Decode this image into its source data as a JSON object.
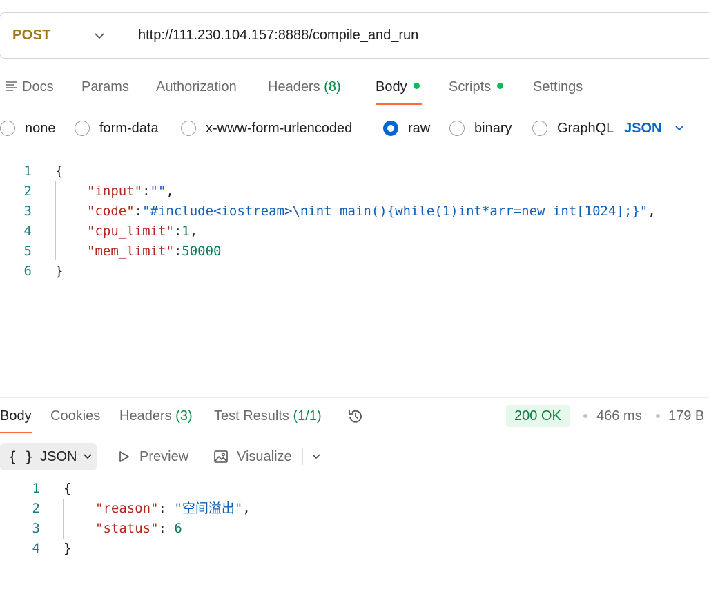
{
  "request": {
    "method": "POST",
    "url": "http://111.230.104.157:8888/compile_and_run"
  },
  "request_tabs": {
    "docs": "Docs",
    "params": "Params",
    "authorization": "Authorization",
    "headers": "Headers",
    "headers_count": "(8)",
    "body": "Body",
    "scripts": "Scripts",
    "settings": "Settings",
    "active": "Body"
  },
  "body_types": {
    "none": "none",
    "form_data": "form-data",
    "urlencoded": "x-www-form-urlencoded",
    "raw": "raw",
    "binary": "binary",
    "graphql": "GraphQL",
    "selected": "raw",
    "format": "JSON"
  },
  "request_body": {
    "line_numbers": [
      "1",
      "2",
      "3",
      "4",
      "5",
      "6"
    ],
    "open_brace": "{",
    "close_brace": "}",
    "input_key": "\"input\"",
    "input_value": "\"\"",
    "code_key": "\"code\"",
    "code_value": "\"#include<iostream>\\nint main(){while(1)int*arr=new int[1024];}\"",
    "cpu_limit_key": "\"cpu_limit\"",
    "cpu_limit_value": "1",
    "mem_limit_key": "\"mem_limit\"",
    "mem_limit_value": "50000"
  },
  "response_tabs": {
    "body": "Body",
    "cookies": "Cookies",
    "headers": "Headers",
    "headers_count": "(3)",
    "test_results": "Test Results",
    "test_results_count": "(1/1)",
    "active": "Body"
  },
  "response_meta": {
    "status": "200 OK",
    "time": "466 ms",
    "size": "179 B"
  },
  "response_toolbar": {
    "format_braces": "{ }",
    "format": "JSON",
    "preview": "Preview",
    "visualize": "Visualize"
  },
  "response_body": {
    "line_numbers": [
      "1",
      "2",
      "3",
      "4"
    ],
    "open_brace": "{",
    "close_brace": "}",
    "reason_key": "\"reason\"",
    "reason_value": "\"空间溢出\"",
    "status_key": "\"status\"",
    "status_value": "6"
  },
  "colors": {
    "method": "#a0771c",
    "accent_tab": "#ff6c37",
    "radio_selected": "#0265d2",
    "status_ok": "#0b7c3e",
    "dot_green": "#0cbb52"
  }
}
